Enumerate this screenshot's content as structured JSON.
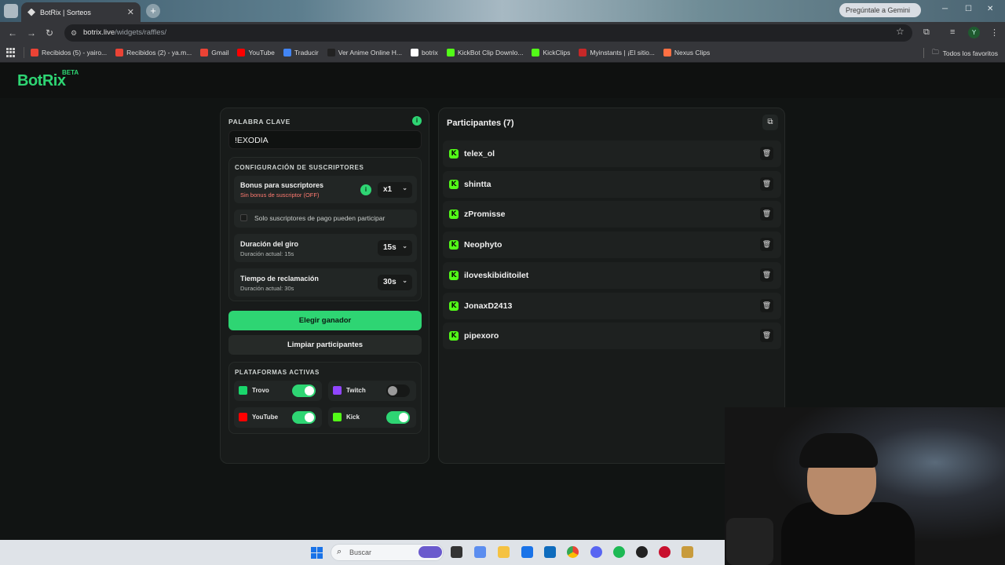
{
  "browser": {
    "tab_title": "BotRix | Sorteos",
    "tab_close": "✕",
    "new_tab": "+",
    "gemini_button": "Pregúntale a Gemini",
    "url_domain": "botrix.live",
    "url_path": "/widgets/raffles/",
    "profile_initial": "Y",
    "bookmarks": [
      {
        "label": "Recibidos (5) - yairo...",
        "color": "#ea4335"
      },
      {
        "label": "Recibidos (2) - ya.m...",
        "color": "#ea4335"
      },
      {
        "label": "Gmail",
        "color": "#ea4335"
      },
      {
        "label": "YouTube",
        "color": "#ff0000"
      },
      {
        "label": "Traducir",
        "color": "#4285f4"
      },
      {
        "label": "Ver Anime Online H...",
        "color": "#222222"
      },
      {
        "label": "botrix",
        "color": "#ffffff"
      },
      {
        "label": "KickBot Clip Downlo...",
        "color": "#53fc18"
      },
      {
        "label": "KickClips",
        "color": "#53fc18"
      },
      {
        "label": "Myinstants | ¡El sitio...",
        "color": "#c62828"
      },
      {
        "label": "Nexus Clips",
        "color": "#ff7043"
      }
    ],
    "all_favorites": "Todos los favoritos"
  },
  "app": {
    "logo": "BotRix",
    "logo_badge": "BETA",
    "accent": "#2ed573"
  },
  "keyword": {
    "label": "PALABRA CLAVE",
    "value": "!EXODIA",
    "info": "i"
  },
  "subscriber_config": {
    "title": "CONFIGURACIÓN DE SUSCRIPTORES",
    "bonus_title": "Bonus para suscriptores",
    "bonus_sub": "Sin bonus de suscriptor (OFF)",
    "bonus_value": "x1",
    "paid_only_label": "Solo suscriptores de pago pueden participar",
    "spin_title": "Duración del giro",
    "spin_sub": "Duración actual: 15s",
    "spin_value": "15s",
    "claim_title": "Tiempo de reclamación",
    "claim_sub": "Duración actual: 30s",
    "claim_value": "30s"
  },
  "actions": {
    "pick_winner": "Elegir ganador",
    "clear_participants": "Limpiar participantes"
  },
  "platforms": {
    "title": "PLATAFORMAS ACTIVAS",
    "items": [
      {
        "name": "Trovo",
        "enabled": true,
        "color": "#19d66b"
      },
      {
        "name": "Twitch",
        "enabled": false,
        "color": "#9146ff"
      },
      {
        "name": "YouTube",
        "enabled": true,
        "color": "#ff0000"
      },
      {
        "name": "Kick",
        "enabled": true,
        "color": "#53fc18"
      }
    ]
  },
  "participants": {
    "title": "Participantes (7)",
    "list": [
      "telex_ol",
      "shintta",
      "zPromisse",
      "Neophyto",
      "iloveskibiditoilet",
      "JonaxD2413",
      "pipexoro"
    ]
  },
  "taskbar": {
    "search_placeholder": "Buscar"
  }
}
